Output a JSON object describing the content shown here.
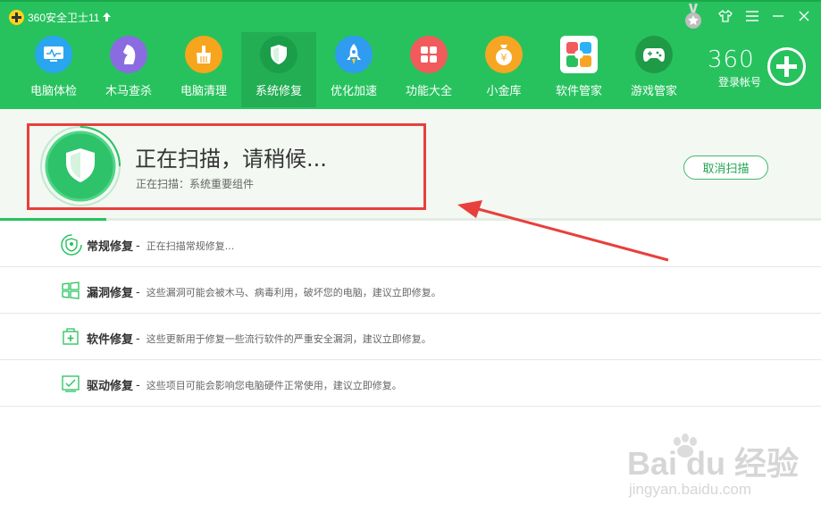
{
  "app": {
    "title": "360安全卫士11"
  },
  "nav": [
    {
      "label": "电脑体检",
      "icon": "monitor-icon",
      "color": "#2aa5f0"
    },
    {
      "label": "木马查杀",
      "icon": "horse-icon",
      "color": "#8a6ce0"
    },
    {
      "label": "电脑清理",
      "icon": "broom-icon",
      "color": "#f7a51c"
    },
    {
      "label": "系统修复",
      "icon": "shield-icon",
      "color": "#1a9e49"
    },
    {
      "label": "优化加速",
      "icon": "rocket-icon",
      "color": "#2f9cf0"
    },
    {
      "label": "功能大全",
      "icon": "grid-icon",
      "color": "#f25b5b"
    },
    {
      "label": "小金库",
      "icon": "money-bag-icon",
      "color": "#f6a623"
    },
    {
      "label": "软件管家",
      "icon": "apps-icon",
      "color": "#2bb3f5"
    },
    {
      "label": "游戏管家",
      "icon": "gamepad-icon",
      "color": "#1f9a46"
    }
  ],
  "nav_active_index": 3,
  "login": {
    "logo": "360",
    "label": "登录帐号"
  },
  "scan": {
    "title": "正在扫描，请稍候...",
    "subtitle": "正在扫描：系统重要组件",
    "cancel_label": "取消扫描",
    "progress": 0.13
  },
  "rows": [
    {
      "name": "常规修复",
      "desc": "正在扫描常规修复...",
      "icon": "shield-check-icon"
    },
    {
      "name": "漏洞修复",
      "desc": "这些漏洞可能会被木马、病毒利用，破坏您的电脑，建议立即修复。",
      "icon": "windows-icon"
    },
    {
      "name": "软件修复",
      "desc": "这些更新用于修复一些流行软件的严重安全漏洞，建议立即修复。",
      "icon": "software-box-icon"
    },
    {
      "name": "驱动修复",
      "desc": "这些项目可能会影响您电脑硬件正常使用，建议立即修复。",
      "icon": "driver-icon"
    }
  ],
  "row_dash": " -",
  "watermark": {
    "main": "Bai du 经验",
    "url": "jingyan.baidu.com"
  },
  "colors": {
    "header": "#27c25e",
    "accent": "#22a64f",
    "annotation": "#e8403c"
  }
}
